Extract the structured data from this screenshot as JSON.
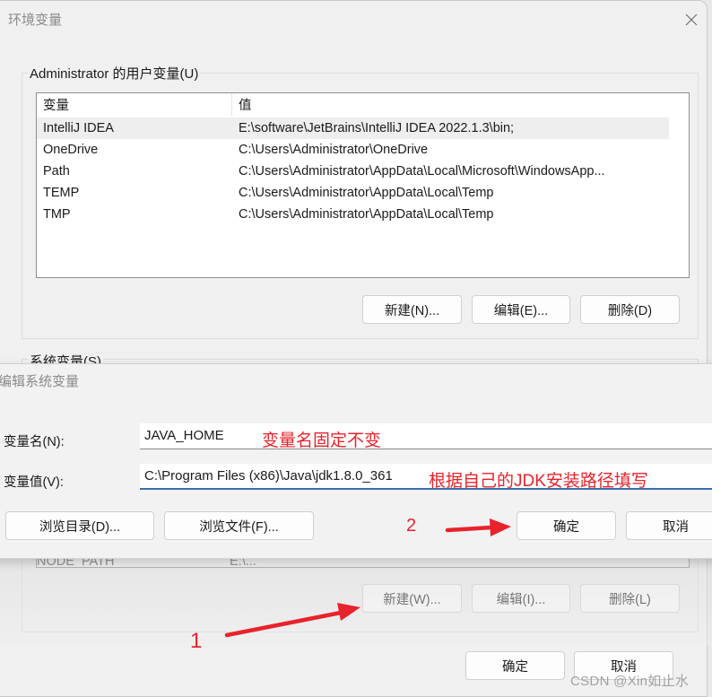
{
  "env_window": {
    "title": "环境变量",
    "user_group_label": "Administrator 的用户变量(U)",
    "user_vars": {
      "columns": [
        "变量",
        "值"
      ],
      "rows": [
        {
          "name": "IntelliJ IDEA",
          "value": "E:\\software\\JetBrains\\IntelliJ IDEA 2022.1.3\\bin;",
          "selected": true
        },
        {
          "name": "OneDrive",
          "value": "C:\\Users\\Administrator\\OneDrive"
        },
        {
          "name": "Path",
          "value": "C:\\Users\\Administrator\\AppData\\Local\\Microsoft\\WindowsApp..."
        },
        {
          "name": "TEMP",
          "value": "C:\\Users\\Administrator\\AppData\\Local\\Temp"
        },
        {
          "name": "TMP",
          "value": "C:\\Users\\Administrator\\AppData\\Local\\Temp"
        }
      ]
    },
    "user_buttons": {
      "new": "新建(N)...",
      "edit": "编辑(E)...",
      "delete": "删除(D)"
    },
    "sys_group_label": "系统变量(S)",
    "sys_vars_partial_row": {
      "name": "NODE_PATH",
      "value": "E:\\..."
    },
    "sys_buttons": {
      "new": "新建(W)...",
      "edit": "编辑(I)...",
      "delete": "删除(L)"
    },
    "footer_buttons": {
      "ok": "确定",
      "cancel": "取消"
    }
  },
  "edit_dialog": {
    "title": "编辑系统变量",
    "name_label": "变量名(N):",
    "name_value": "JAVA_HOME",
    "value_label": "变量值(V):",
    "value_value": "C:\\Program Files (x86)\\Java\\jdk1.8.0_361",
    "browse_dir": "浏览目录(D)...",
    "browse_file": "浏览文件(F)...",
    "ok": "确定",
    "cancel": "取消"
  },
  "annotations": {
    "name_note": "变量名固定不变",
    "value_note": "根据自己的JDK安装路径填写",
    "step1": "1",
    "step2": "2",
    "accent_color": "#e8232b"
  },
  "watermark": "CSDN @Xin如止水"
}
